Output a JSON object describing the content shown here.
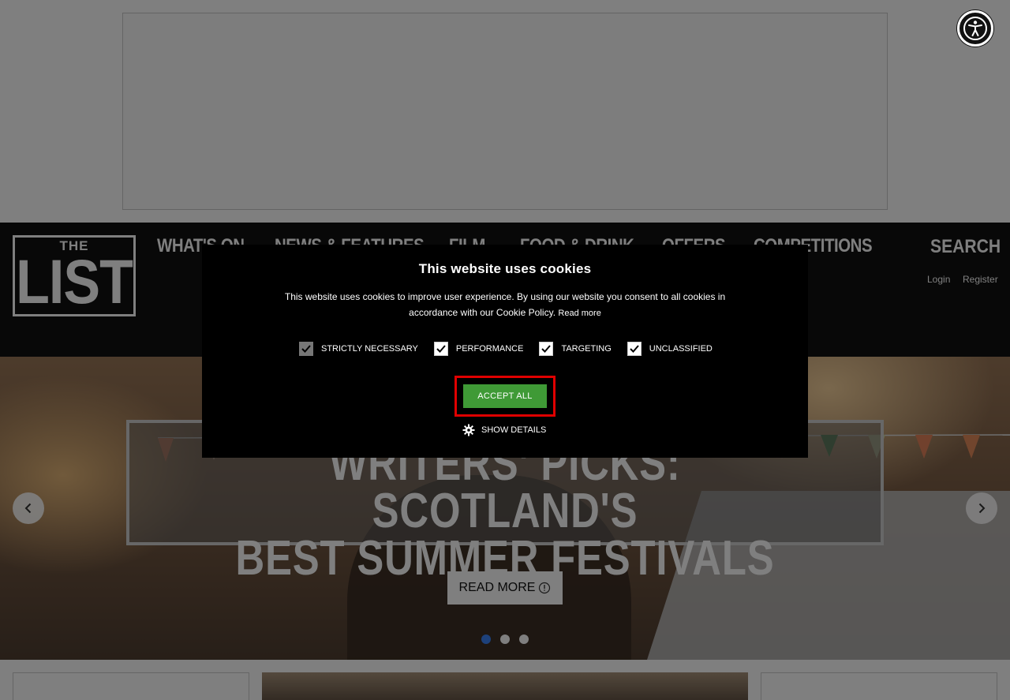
{
  "header": {
    "logo_top": "THE",
    "logo_main": "LIST",
    "nav": [
      "WHAT'S ON",
      "NEWS & FEATURES",
      "FILM",
      "FOOD & DRINK",
      "OFFERS",
      "COMPETITIONS"
    ],
    "search": "SEARCH",
    "login": "Login",
    "register": "Register"
  },
  "hero": {
    "headline_line1": "WRITERS' PICKS: SCOTLAND'S",
    "headline_line2": "BEST SUMMER FESTIVALS",
    "read_more": "READ MORE",
    "slides": 3,
    "active_slide": 1
  },
  "cookie": {
    "title": "This website uses cookies",
    "body": "This website uses cookies to improve user experience. By using our website you consent to all cookies in accordance with our Cookie Policy.",
    "read_more": "Read more",
    "options": [
      "STRICTLY NECESSARY",
      "PERFORMANCE",
      "TARGETING",
      "UNCLASSIFIED"
    ],
    "accept": "ACCEPT ALL",
    "details": "SHOW DETAILS"
  },
  "icons": {
    "accessibility": "accessibility-icon",
    "prev": "chevron-left-icon",
    "next": "chevron-right-icon",
    "gear": "gear-icon",
    "info": "info-icon"
  },
  "colors": {
    "accept": "#3f9a36",
    "highlight": "#e00000",
    "active_dot": "#3b82f6",
    "header_bg": "#111111"
  }
}
